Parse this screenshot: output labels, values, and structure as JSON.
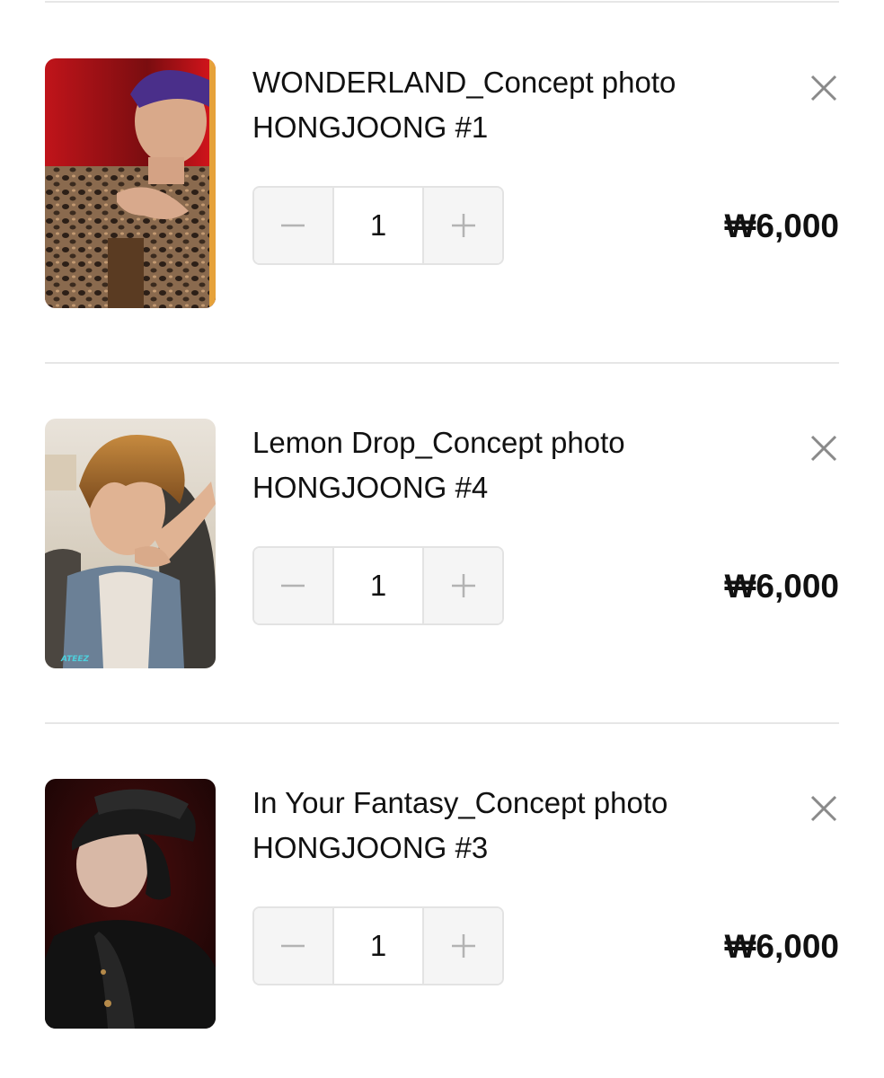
{
  "cart": {
    "items": [
      {
        "title_line1": "WONDERLAND_Concept photo",
        "title_line2": "HONGJOONG #1",
        "quantity": "1",
        "price": "₩6,000",
        "thumbnail": "photocard-hongjoong-leopard-jacket"
      },
      {
        "title_line1": "Lemon Drop_Concept photo",
        "title_line2": "HONGJOONG #4",
        "quantity": "1",
        "price": "₩6,000",
        "thumbnail": "photocard-hongjoong-denim-vest",
        "thumbnail_watermark": "ATEEZ"
      },
      {
        "title_line1": "In Your Fantasy_Concept photo",
        "title_line2": "HONGJOONG #3",
        "quantity": "1",
        "price": "₩6,000",
        "thumbnail": "photocard-hongjoong-leather-cap"
      }
    ]
  },
  "icons": {
    "remove": "close-icon",
    "decrease": "minus-icon",
    "increase": "plus-icon"
  }
}
